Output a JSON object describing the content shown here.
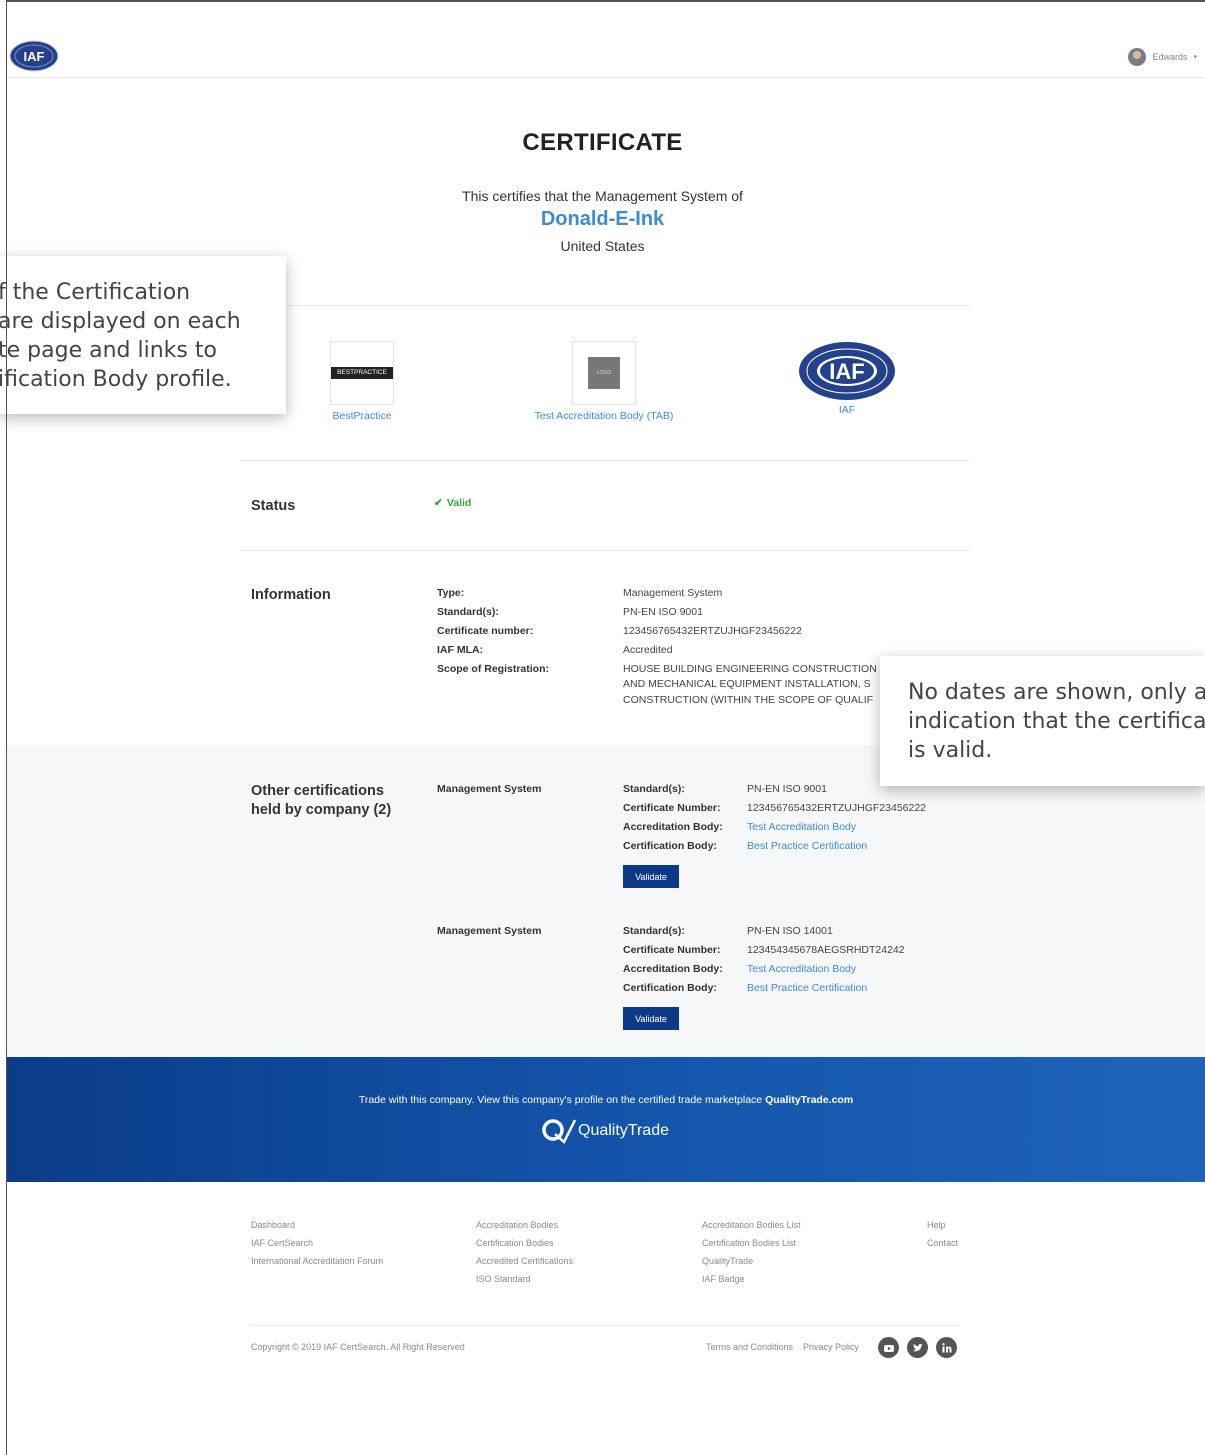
{
  "header": {
    "logo_text": "IAF",
    "user_name": "Edwards",
    "user_caret": "▾"
  },
  "certificate": {
    "title": "CERTIFICATE",
    "subtitle": "This certifies that the Management System of",
    "company_name": "Donald-E-Ink",
    "country": "United States"
  },
  "bodies": [
    {
      "logo_text": "BESTPRACTICE",
      "name": "BestPractice"
    },
    {
      "logo_text": "LOGO",
      "name": "Test Accreditation Body (TAB)"
    },
    {
      "logo_text": "IAF",
      "name": "IAF"
    }
  ],
  "status": {
    "label": "Status",
    "check": "✔",
    "value": "Valid"
  },
  "information": {
    "label": "Information",
    "rows": [
      {
        "key": "Type:",
        "value": "Management System"
      },
      {
        "key": "Standard(s):",
        "value": "PN-EN ISO 9001"
      },
      {
        "key": "Certificate number:",
        "value": "123456765432ERTZUJHGF23456222"
      },
      {
        "key": "IAF MLA:",
        "value": "Accredited"
      },
      {
        "key": "Scope of Registration:",
        "value_lines": [
          "HOUSE BUILDING ENGINEERING CONSTRUCTION",
          "AND MECHANICAL EQUIPMENT INSTALLATION, S",
          "CONSTRUCTION (WITHIN THE SCOPE OF QUALIF"
        ]
      }
    ]
  },
  "other_certifications": {
    "label_line1": "Other certifications",
    "label_line2": "held by company (2)",
    "items": [
      {
        "type": "Management System",
        "standard_key": "Standard(s):",
        "standard": "PN-EN ISO 9001",
        "number_key": "Certificate Number:",
        "number": "123456765432ERTZUJHGF23456222",
        "ab_key": "Accreditation Body:",
        "ab": "Test Accreditation Body",
        "cb_key": "Certification Body:",
        "cb": "Best Practice Certification",
        "button": "Validate"
      },
      {
        "type": "Management System",
        "standard_key": "Standard(s):",
        "standard": "PN-EN ISO 14001",
        "number_key": "Certificate Number:",
        "number": "123454345678AEGSRHDT24242",
        "ab_key": "Accreditation Body:",
        "ab": "Test Accreditation Body",
        "cb_key": "Certification Body:",
        "cb": "Best Practice Certification",
        "button": "Validate"
      }
    ]
  },
  "banner": {
    "text_prefix": "Trade with this company. View this company's profile on the certified trade marketplace ",
    "text_link": "QualityTrade.com",
    "brand": "QualityTrade"
  },
  "footer": {
    "col1": [
      "Dashboard",
      "IAF CertSearch",
      "International Accreditation Forum"
    ],
    "col2": [
      "Accreditation Bodies",
      "Certification Bodies",
      "Accredited Certifications",
      "ISO Standard"
    ],
    "col3": [
      "Accreditation Bodies List",
      "Certification Bodies List",
      "QualityTrade",
      "IAF Badge"
    ],
    "col4": [
      "Help",
      "Contact"
    ],
    "copyright": "Copyright © 2019 IAF CertSearch. All Right Reserved",
    "terms": "Terms and Conditions",
    "privacy": "Privacy Policy",
    "social": [
      "youtube-icon",
      "twitter-icon",
      "linkedin-icon"
    ]
  },
  "callouts": {
    "left": "f the Certification\nare displayed on each\nte page and links to\nification Body profile.",
    "right": "No dates are shown, only a\nindication that the certifica\nis valid."
  },
  "colors": {
    "link": "#3d8bd1",
    "valid": "#3aa13a",
    "button": "#0d3a86",
    "banner": "#0a3c89"
  }
}
